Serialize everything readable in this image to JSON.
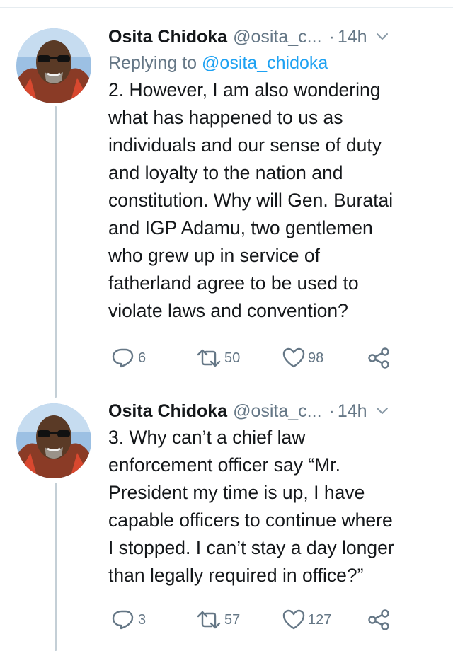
{
  "tweets": [
    {
      "name": "Osita Chidoka",
      "handle": "@osita_c...",
      "dot": "·",
      "time": "14h",
      "reply_prefix": "Replying to",
      "reply_handle": "@osita_chidoka",
      "text": "2. However, I am also wondering\nwhat has happened to us as\nindividuals and our sense of duty\nand loyalty to the nation and\nconstitution. Why will Gen. Buratai\nand IGP Adamu, two gentlemen\nwho grew up in service of\nfatherland agree to be used to\nviolate laws and convention?",
      "replies": "6",
      "retweets": "50",
      "likes": "98"
    },
    {
      "name": "Osita Chidoka",
      "handle": "@osita_c...",
      "dot": "·",
      "time": "14h",
      "text": "3. Why can’t a chief law\nenforcement officer say “Mr.\nPresident my time is up, I have\ncapable officers to continue where\nI stopped. I can’t stay a day longer\nthan legally required in office?”",
      "replies": "3",
      "retweets": "57",
      "likes": "127"
    }
  ],
  "icons": {
    "reply": "reply-icon",
    "retweet": "retweet-icon",
    "like": "heart-icon",
    "share": "share-icon",
    "menu": "chevron-down-icon"
  },
  "colors": {
    "name": "#14171a",
    "secondary": "#657786",
    "link": "#1da1f2",
    "thread_line": "#c4cfd6"
  }
}
